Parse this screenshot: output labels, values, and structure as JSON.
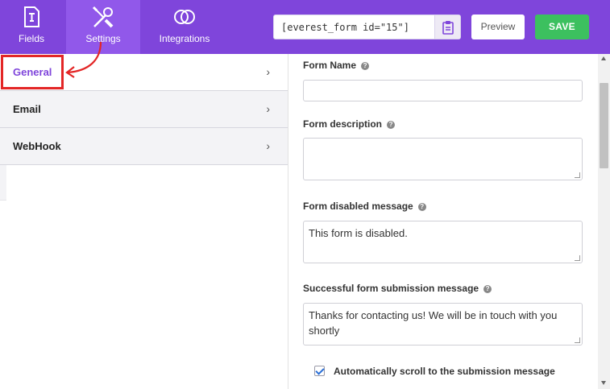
{
  "tabs": [
    {
      "label": "Fields",
      "icon": "form-fields-icon"
    },
    {
      "label": "Settings",
      "icon": "tools-icon",
      "active": true
    },
    {
      "label": "Integrations",
      "icon": "integrations-icon"
    }
  ],
  "shortcode": "[everest_form id=\"15\"]",
  "buttons": {
    "preview": "Preview",
    "save": "SAVE"
  },
  "sidebar": {
    "items": [
      {
        "label": "General",
        "chevron": "›",
        "active": true
      },
      {
        "label": "Email",
        "chevron": "›"
      },
      {
        "label": "WebHook",
        "chevron": "›"
      }
    ]
  },
  "form": {
    "name_label": "Form Name",
    "name_value": "",
    "description_label": "Form description",
    "description_value": "",
    "disabled_label": "Form disabled message",
    "disabled_value": "This form is disabled.",
    "success_label": "Successful form submission message",
    "success_value": "Thanks for contacting us! We will be in touch with you shortly",
    "scroll_label": "Automatically scroll to the submission message",
    "scroll_checked": true,
    "help_glyph": "?"
  },
  "colors": {
    "brand_purple": "#7f45db",
    "save_green": "#3cc05f",
    "highlight_red": "#e32626"
  }
}
